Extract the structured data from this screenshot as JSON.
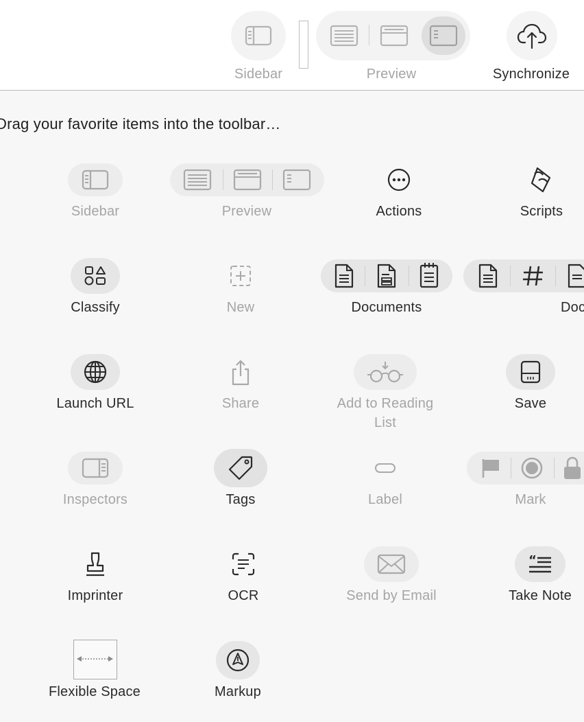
{
  "toolbar": {
    "sidebar_label": "Sidebar",
    "preview_label": "Preview",
    "sync_label": "Synchronize"
  },
  "palette": {
    "hint": "Drag your favorite items into the toolbar…",
    "items": {
      "sidebar": "Sidebar",
      "preview": "Preview",
      "actions": "Actions",
      "scripts": "Scripts",
      "classify": "Classify",
      "new": "New",
      "documents": "Documents",
      "doc_partial": "Doc",
      "launch_url": "Launch URL",
      "share": "Share",
      "add_reading_list_1": "Add to Reading",
      "add_reading_list_2": "List",
      "save": "Save",
      "inspectors": "Inspectors",
      "tags": "Tags",
      "label": "Label",
      "mark": "Mark",
      "imprinter": "Imprinter",
      "ocr": "OCR",
      "send_by_email": "Send by Email",
      "take_note": "Take Note",
      "flexible_space": "Flexible Space",
      "markup": "Markup"
    }
  },
  "colors": {
    "toolbar_bg": "#ffffff",
    "palette_bg": "#f7f7f7",
    "pill_bg": "#e9e9e9",
    "pill_active": "#dcdcdc",
    "text_enabled": "#2a2a2a",
    "text_disabled": "#a5a5a5"
  }
}
